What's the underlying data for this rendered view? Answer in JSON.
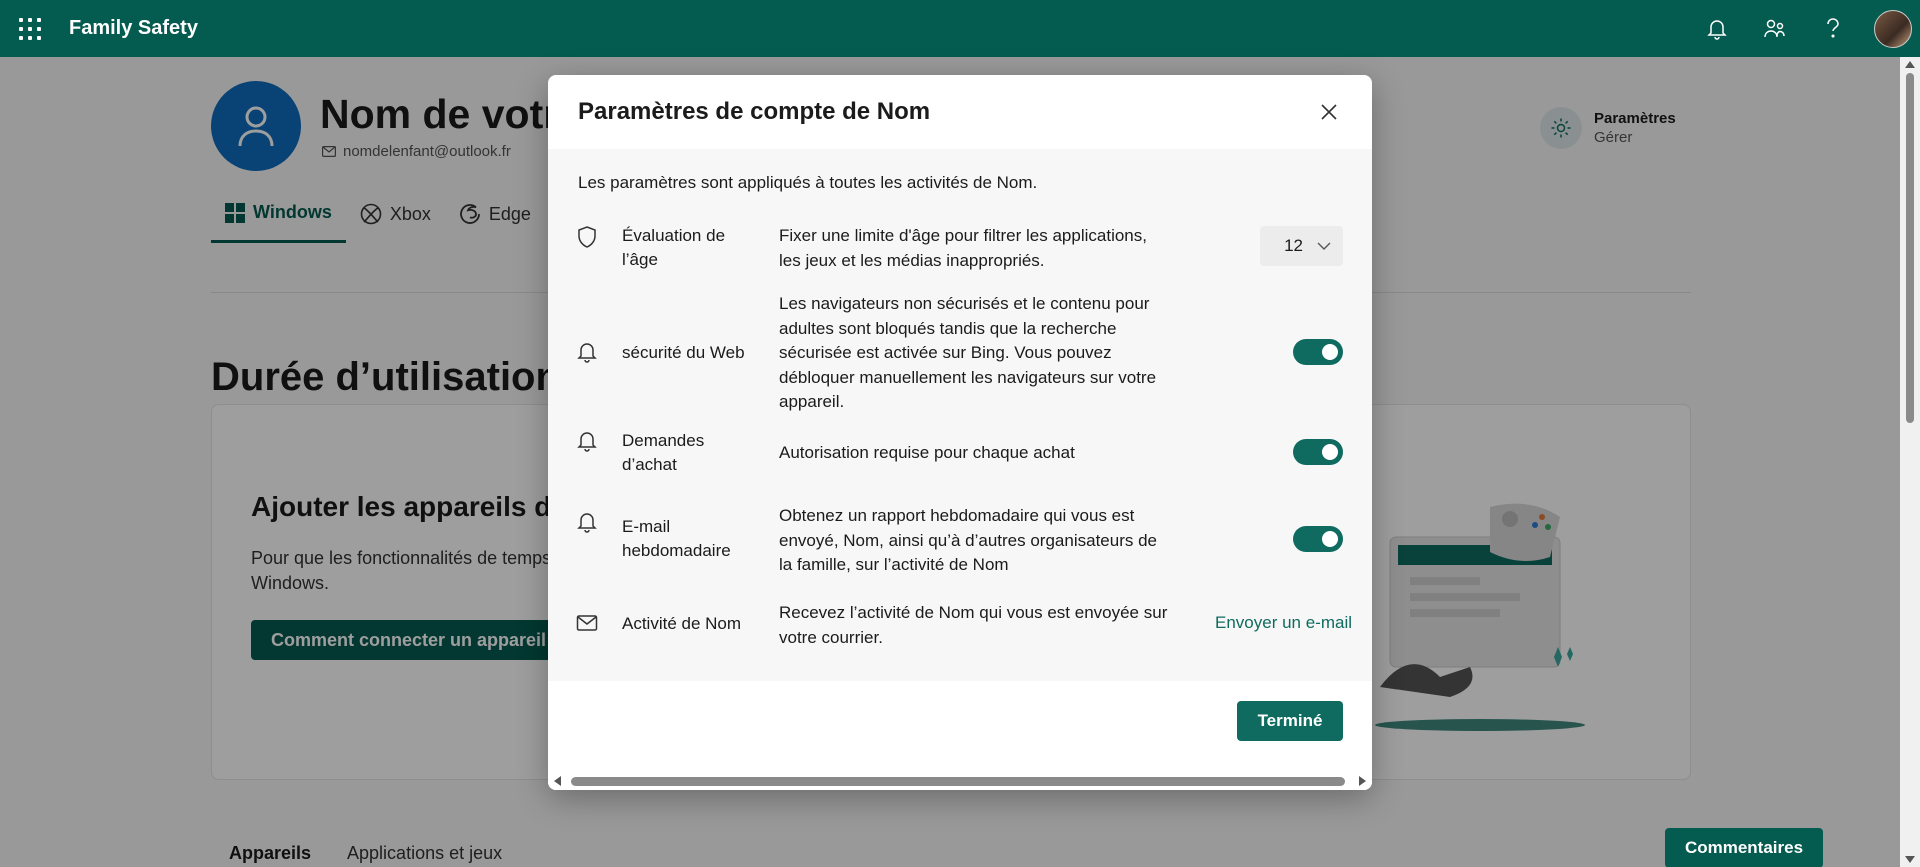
{
  "app": {
    "name": "Family Safety"
  },
  "topbar": {
    "icons": [
      "waffle-icon",
      "bell-icon",
      "family-icon",
      "help-icon",
      "avatar"
    ]
  },
  "profile": {
    "name": "Nom de votr",
    "email": "nomdelenfant@outlook.fr"
  },
  "settings_link": {
    "title": "Paramètres",
    "subtitle": "Gérer"
  },
  "tabs": [
    {
      "label": "Windows",
      "icon": "windows-icon",
      "active": true
    },
    {
      "label": "Xbox",
      "icon": "xbox-icon",
      "active": false
    },
    {
      "label": "Edge",
      "icon": "edge-icon",
      "active": false
    }
  ],
  "section": {
    "title": "Durée d’utilisation"
  },
  "card": {
    "title": "Ajouter les appareils d",
    "text": "Pour que les fonctionnalités de temps d Windows.",
    "button": "Comment connecter un appareil"
  },
  "bottom_tabs": [
    {
      "label": "Appareils",
      "active": true
    },
    {
      "label": "Applications et jeux",
      "active": false
    }
  ],
  "feedback_button": "Commentaires",
  "modal": {
    "title": "Paramètres de compte de Nom",
    "intro": "Les paramètres sont appliqués à toutes les activités de Nom.",
    "rows": [
      {
        "icon": "shield-icon",
        "label": "Évaluation de l’âge",
        "description": "Fixer une limite d'âge pour filtrer les applications, les jeux et les médias inappropriés.",
        "control": "select",
        "value": "12"
      },
      {
        "icon": "bell-icon",
        "label": "sécurité du Web",
        "description": "Les navigateurs non sécurisés et le contenu pour adultes sont bloqués tandis que la recherche sécurisée est activée sur Bing. Vous pouvez débloquer manuellement les navigateurs sur votre appareil.",
        "control": "toggle",
        "on": true
      },
      {
        "icon": "bell-icon",
        "label": "Demandes d’achat",
        "description": "Autorisation requise pour chaque achat",
        "control": "toggle",
        "on": true
      },
      {
        "icon": "bell-icon",
        "label": "E-mail hebdomadaire",
        "description": "Obtenez un rapport hebdomadaire qui vous est envoyé, Nom, ainsi qu’à d’autres organisateurs de la famille, sur l’activité de Nom",
        "control": "toggle",
        "on": true
      },
      {
        "icon": "mail-icon",
        "label": "Activité de Nom",
        "description": "Recevez l’activité de Nom qui vous est envoyée sur votre courrier.",
        "control": "link",
        "link_label": "Envoyer un e-mail"
      }
    ],
    "done_button": "Terminé"
  },
  "colors": {
    "brand": "#045b4f",
    "toggle_on": "#0f6b5f",
    "profile": "#0f6cbd"
  }
}
